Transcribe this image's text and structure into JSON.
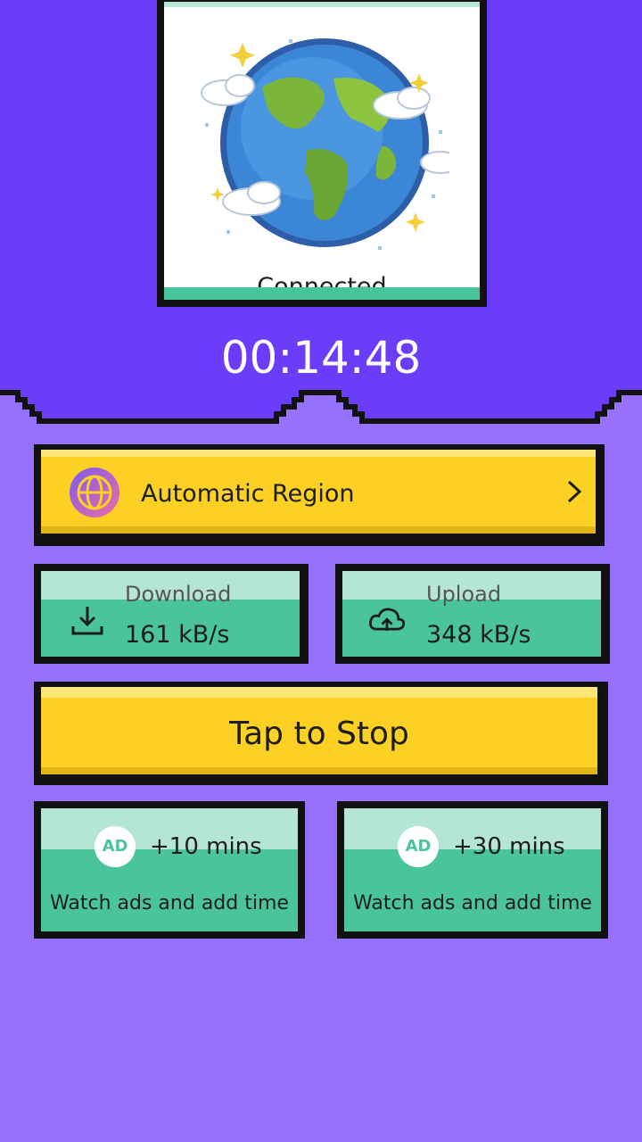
{
  "status": {
    "label": "Connected"
  },
  "timer": {
    "value": "00:14:48"
  },
  "region": {
    "label": "Automatic Region",
    "icon": "globe-icon",
    "chevron": "chevron-right-icon"
  },
  "download": {
    "title": "Download",
    "value": "161 kB/s",
    "icon": "download-icon"
  },
  "upload": {
    "title": "Upload",
    "value": "348 kB/s",
    "icon": "cloud-upload-icon"
  },
  "stop": {
    "label": "Tap to Stop"
  },
  "ads": [
    {
      "badge": "AD",
      "time": "+10 mins",
      "desc": "Watch ads and add time"
    },
    {
      "badge": "AD",
      "time": "+30 mins",
      "desc": "Watch ads and add time"
    }
  ],
  "colors": {
    "top_bg": "#6b3df8",
    "bottom_bg": "#9671fb",
    "yellow": "#fcd124",
    "green": "#4ac49b",
    "light_green": "#b5e6d5"
  }
}
